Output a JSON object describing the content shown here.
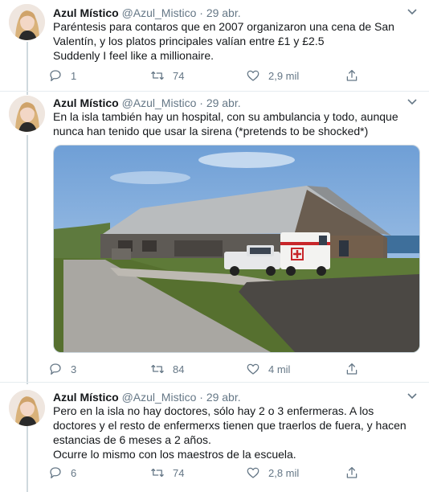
{
  "tweets": [
    {
      "name": "Azul Místico",
      "handle": "@Azul_Mistico",
      "date": "29 abr.",
      "text": "Paréntesis para contaros que en 2007 organizaron una cena de San Valentín, y los platos principales valían entre £1 y £2.5\nSuddenly I feel like a millionaire.",
      "replies": "1",
      "retweets": "74",
      "likes": "2,9 mil"
    },
    {
      "name": "Azul Místico",
      "handle": "@Azul_Mistico",
      "date": "29 abr.",
      "text": "En la isla también hay un hospital, con su ambulancia y todo, aunque nunca han tenido que usar la sirena (*pretends to be shocked*)",
      "replies": "3",
      "retweets": "84",
      "likes": "4 mil"
    },
    {
      "name": "Azul Místico",
      "handle": "@Azul_Mistico",
      "date": "29 abr.",
      "text": "Pero en la isla no hay doctores, sólo hay 2 o 3 enfermeras. A los doctores y el resto de enfermerxs tienen que traerlos de fuera, y hacen estancias de 6 meses a 2 años.\nOcurre lo mismo con los maestros de la escuela.",
      "replies": "6",
      "retweets": "74",
      "likes": "2,8 mil"
    }
  ],
  "icons": {
    "reply": "reply-icon",
    "retweet": "retweet-icon",
    "like": "heart-icon",
    "share": "share-icon",
    "more": "chevron-down-icon"
  },
  "colors": {
    "text": "#14171a",
    "secondary": "#657786",
    "thread_line": "#cfd9de",
    "separator": "#e6ecf0"
  }
}
